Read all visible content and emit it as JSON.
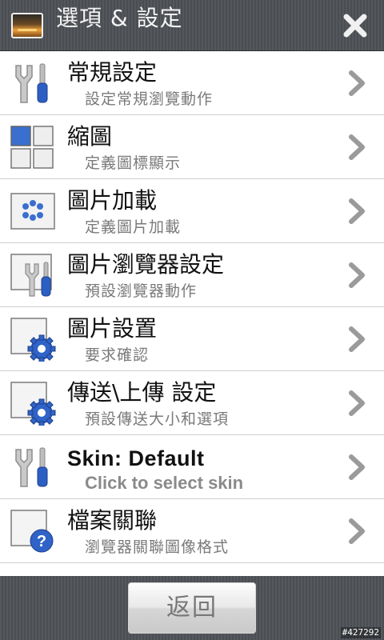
{
  "header": {
    "title": "選項 & 設定",
    "app_icon": "sunset-photo-icon",
    "close_icon": "close-icon"
  },
  "list": {
    "items": [
      {
        "title": "常規設定",
        "subtitle": "設定常規瀏覽動作",
        "icon": "tools-icon"
      },
      {
        "title": "縮圖",
        "subtitle": "定義圖標顯示",
        "icon": "thumbnail-grid-icon"
      },
      {
        "title": "圖片加載",
        "subtitle": "定義圖片加載",
        "icon": "image-loading-icon"
      },
      {
        "title": "圖片瀏覽器設定",
        "subtitle": "預設瀏覽器動作",
        "icon": "viewer-tools-icon"
      },
      {
        "title": "圖片設置",
        "subtitle": "要求確認",
        "icon": "image-gear-icon"
      },
      {
        "title": "傳送\\上傳 設定",
        "subtitle": "預設傳送大小和選項",
        "icon": "upload-gear-icon"
      },
      {
        "title": "Skin: Default",
        "subtitle": "Click to select skin",
        "icon": "skin-tools-icon"
      },
      {
        "title": "檔案關聯",
        "subtitle": "瀏覽器關聯圖像格式",
        "icon": "file-association-help-icon"
      }
    ]
  },
  "footer": {
    "back_label": "返回"
  },
  "watermark": "#427292",
  "colors": {
    "header_bg": "#505358",
    "accent_blue": "#3a6fd0",
    "divider": "#cfcfcf",
    "chevron": "#9a9a9a"
  }
}
